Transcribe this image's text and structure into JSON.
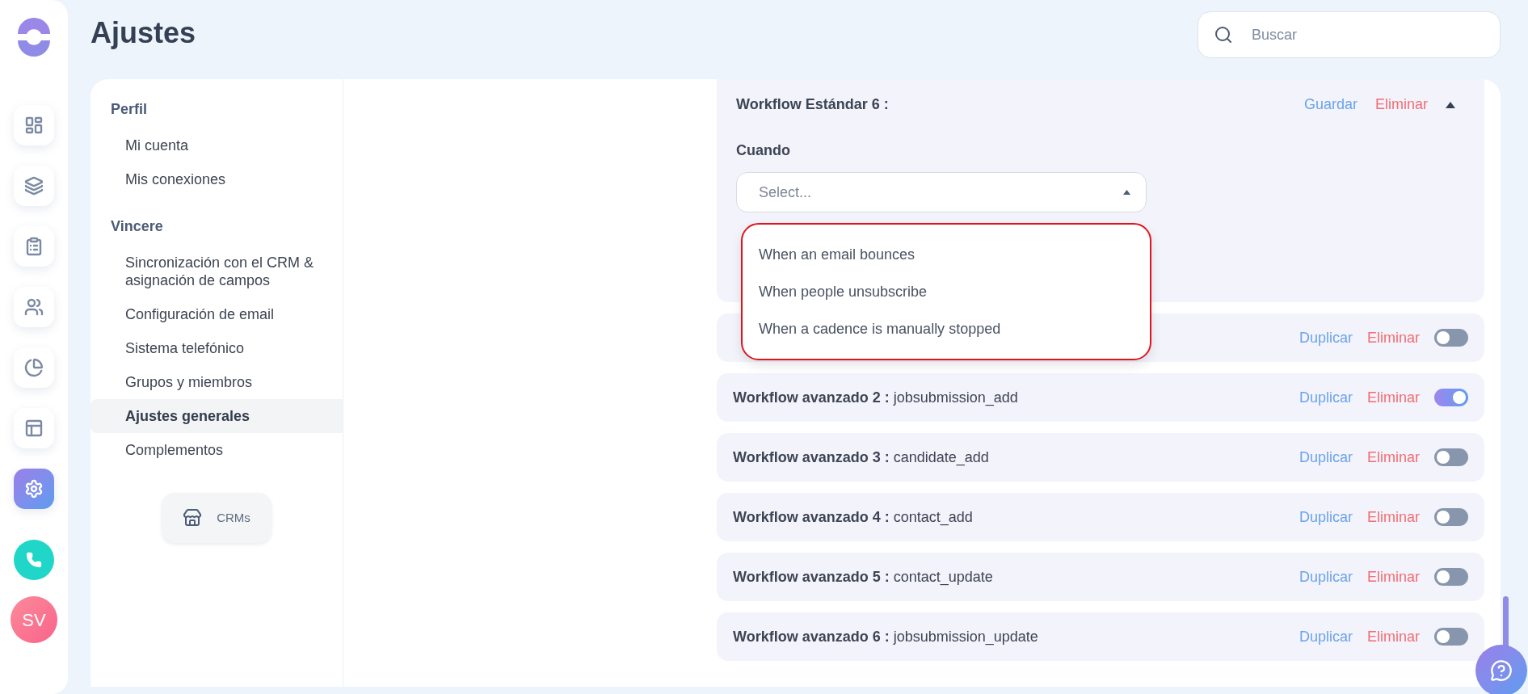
{
  "rail": {
    "items": [
      {
        "kind": "dashboard",
        "selected": false
      },
      {
        "kind": "stack",
        "selected": false
      },
      {
        "kind": "clipboard",
        "selected": false
      },
      {
        "kind": "people",
        "selected": false
      },
      {
        "kind": "pie",
        "selected": false
      },
      {
        "kind": "layout",
        "selected": false
      },
      {
        "kind": "settings",
        "selected": true
      }
    ],
    "avatar": "SV"
  },
  "header": {
    "title": "Ajustes",
    "search": {
      "placeholder": "Buscar"
    }
  },
  "settings_menu": {
    "sections": [
      {
        "heading": "Perfil",
        "items": [
          {
            "label": "Mi cuenta",
            "selected": false
          },
          {
            "label": "Mis conexiones",
            "selected": false
          }
        ]
      },
      {
        "heading": "Vincere",
        "items": [
          {
            "label": "Sincronización con el CRM & asignación de campos",
            "selected": false
          },
          {
            "label": "Configuración de email",
            "selected": false
          },
          {
            "label": "Sistema telefónico",
            "selected": false
          },
          {
            "label": "Grupos y miembros",
            "selected": false
          },
          {
            "label": "Ajustes generales",
            "selected": true
          },
          {
            "label": "Complementos",
            "selected": false
          }
        ]
      }
    ],
    "crm_button": "CRMs"
  },
  "editor": {
    "title": "Workflow Estándar 6 :",
    "save": "Guardar",
    "delete": "Eliminar",
    "expanded": true,
    "field_label": "Cuando",
    "select": {
      "placeholder": "Select...",
      "open": true,
      "options": [
        "When an email bounces",
        "When people unsubscribe",
        "When a cadence is manually stopped"
      ]
    }
  },
  "workflows": [
    {
      "duplicate": "Duplicar",
      "delete": "Eliminar",
      "on": false
    },
    {
      "name": "Workflow avanzado 2 :",
      "trigger": "jobsubmission_add",
      "duplicate": "Duplicar",
      "delete": "Eliminar",
      "on": true
    },
    {
      "name": "Workflow avanzado 3 :",
      "trigger": "candidate_add",
      "duplicate": "Duplicar",
      "delete": "Eliminar",
      "on": false
    },
    {
      "name": "Workflow avanzado 4 :",
      "trigger": "contact_add",
      "duplicate": "Duplicar",
      "delete": "Eliminar",
      "on": false
    },
    {
      "name": "Workflow avanzado 5 :",
      "trigger": "contact_update",
      "duplicate": "Duplicar",
      "delete": "Eliminar",
      "on": false
    },
    {
      "name": "Workflow avanzado 6 :",
      "trigger": "jobsubmission_update",
      "duplicate": "Duplicar",
      "delete": "Eliminar",
      "on": false
    }
  ]
}
